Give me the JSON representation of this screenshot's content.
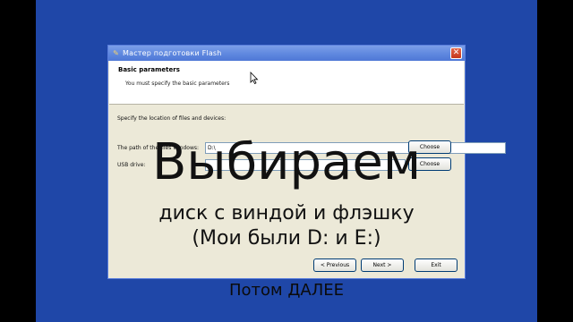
{
  "window": {
    "title": "Мастер подготовки Flash",
    "close_glyph": "✕"
  },
  "header": {
    "title": "Basic parameters",
    "subtitle": "You must specify the basic parameters"
  },
  "body": {
    "instruction": "Specify the location of files and devices:",
    "windows_path_label": "The path of the files Windows:",
    "windows_path_value": "D:\\",
    "usb_label": "USB drive:",
    "choose_label": "Choose"
  },
  "nav": {
    "previous": "< Previous",
    "next": "Next >",
    "exit": "Exit"
  },
  "overlay": {
    "title": "Выбираем",
    "line1": "диск с виндой и флэшку",
    "line2": "(Мои были D: и E:)",
    "footer": "Потом ДАЛЕЕ"
  },
  "colors": {
    "desktop": "#1f47a8",
    "titlebar": "#5d86de",
    "dialog": "#ece9d8"
  },
  "icons": {
    "app": "flash-app-icon",
    "cursor": "mouse-pointer-icon"
  }
}
